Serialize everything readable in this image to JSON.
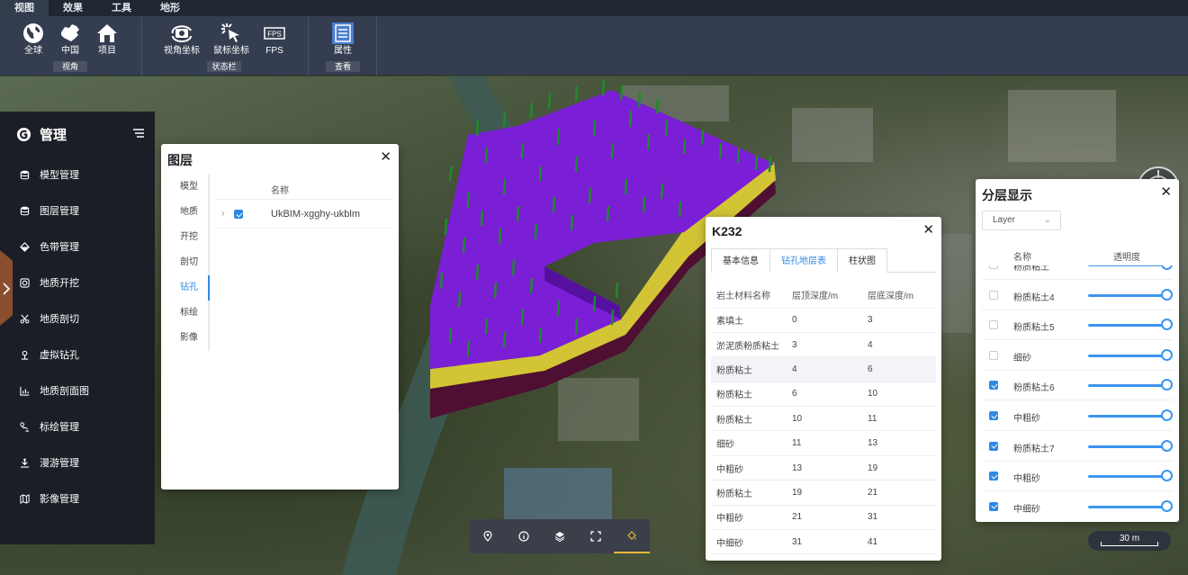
{
  "ribbon": {
    "tabs": [
      {
        "label": "视图",
        "active": true
      },
      {
        "label": "效果"
      },
      {
        "label": "工具"
      },
      {
        "label": "地形"
      }
    ],
    "groups": [
      {
        "label": "视角",
        "buttons": [
          {
            "label": "全球",
            "icon": "globe-icon"
          },
          {
            "label": "中国",
            "icon": "china-map-icon"
          },
          {
            "label": "项目",
            "icon": "home-icon"
          }
        ]
      },
      {
        "label": "状态栏",
        "buttons": [
          {
            "label": "视角坐标",
            "icon": "camera-coordinate-icon"
          },
          {
            "label": "鼠标坐标",
            "icon": "mouse-pointer-icon"
          },
          {
            "label": "FPS",
            "icon": "fps-icon",
            "icon_text": "FPS"
          }
        ]
      },
      {
        "label": "查看",
        "buttons": [
          {
            "label": "属性",
            "icon": "properties-icon"
          }
        ]
      }
    ]
  },
  "sidebar": {
    "title": "管理",
    "items": [
      {
        "label": "模型管理",
        "icon": "database-icon"
      },
      {
        "label": "图层管理",
        "icon": "database-icon"
      },
      {
        "label": "色带管理",
        "icon": "paint-bucket-icon"
      },
      {
        "label": "地质开挖",
        "icon": "dig-icon"
      },
      {
        "label": "地质剖切",
        "icon": "scissors-icon"
      },
      {
        "label": "虚拟钻孔",
        "icon": "drill-icon"
      },
      {
        "label": "地质剖面图",
        "icon": "chart-icon"
      },
      {
        "label": "标绘管理",
        "icon": "plot-icon"
      },
      {
        "label": "漫游管理",
        "icon": "roam-icon"
      },
      {
        "label": "影像管理",
        "icon": "map-icon"
      }
    ]
  },
  "layers_panel": {
    "title": "图层",
    "menu": [
      "模型",
      "地质",
      "开挖",
      "剖切",
      "钻孔",
      "标绘",
      "影像"
    ],
    "active_menu": "钻孔",
    "column_name": "名称",
    "rows": [
      {
        "name": "UkBIM-xgghy-ukblm",
        "checked": true
      }
    ]
  },
  "k232_panel": {
    "title": "K232",
    "tabs": [
      "基本信息",
      "钻孔地层表",
      "柱状图"
    ],
    "active_tab": "钻孔地层表",
    "columns": [
      "岩土材料名称",
      "层顶深度/m",
      "层底深度/m"
    ],
    "rows": [
      [
        "素填土",
        "0",
        "3"
      ],
      [
        "淤泥质粉质粘土",
        "3",
        "4"
      ],
      [
        "粉质粘土",
        "4",
        "6"
      ],
      [
        "粉质粘土",
        "6",
        "10"
      ],
      [
        "粉质粘土",
        "10",
        "11"
      ],
      [
        "细砂",
        "11",
        "13"
      ],
      [
        "中粗砂",
        "13",
        "19"
      ],
      [
        "粉质粘土",
        "19",
        "21"
      ],
      [
        "中粗砂",
        "21",
        "31"
      ],
      [
        "中细砂",
        "31",
        "41"
      ]
    ],
    "highlighted_row": 2
  },
  "strata_panel": {
    "title": "分层显示",
    "select_value": "Layer",
    "col_name": "名称",
    "col_opacity": "透明度",
    "rows": [
      {
        "name": "粉质粘土",
        "checked": false,
        "opacity": 1.0
      },
      {
        "name": "粉质粘土4",
        "checked": false,
        "opacity": 1.0
      },
      {
        "name": "粉质粘土5",
        "checked": false,
        "opacity": 1.0
      },
      {
        "name": "细砂",
        "checked": false,
        "opacity": 1.0
      },
      {
        "name": "粉质粘土6",
        "checked": true,
        "opacity": 1.0
      },
      {
        "name": "中粗砂",
        "checked": true,
        "opacity": 1.0
      },
      {
        "name": "粉质粘土7",
        "checked": true,
        "opacity": 1.0
      },
      {
        "name": "中粗砂",
        "checked": true,
        "opacity": 1.0
      },
      {
        "name": "中细砂",
        "checked": true,
        "opacity": 1.0
      }
    ]
  },
  "bottombar": {
    "buttons": [
      "location-pin-icon",
      "info-icon",
      "layers-icon",
      "fullscreen-icon",
      "paint-bucket-icon"
    ],
    "active": "paint-bucket-icon",
    "active_color": "#e7b63a"
  },
  "scale": {
    "label": "30 m"
  },
  "colors": {
    "model_top": "#7a1fd6",
    "model_side": "#5510a0",
    "model_band": "#d6c83a",
    "model_bottom": "#5a1032",
    "boreholes": "#1f8a2a",
    "accent": "#2f89e4"
  }
}
